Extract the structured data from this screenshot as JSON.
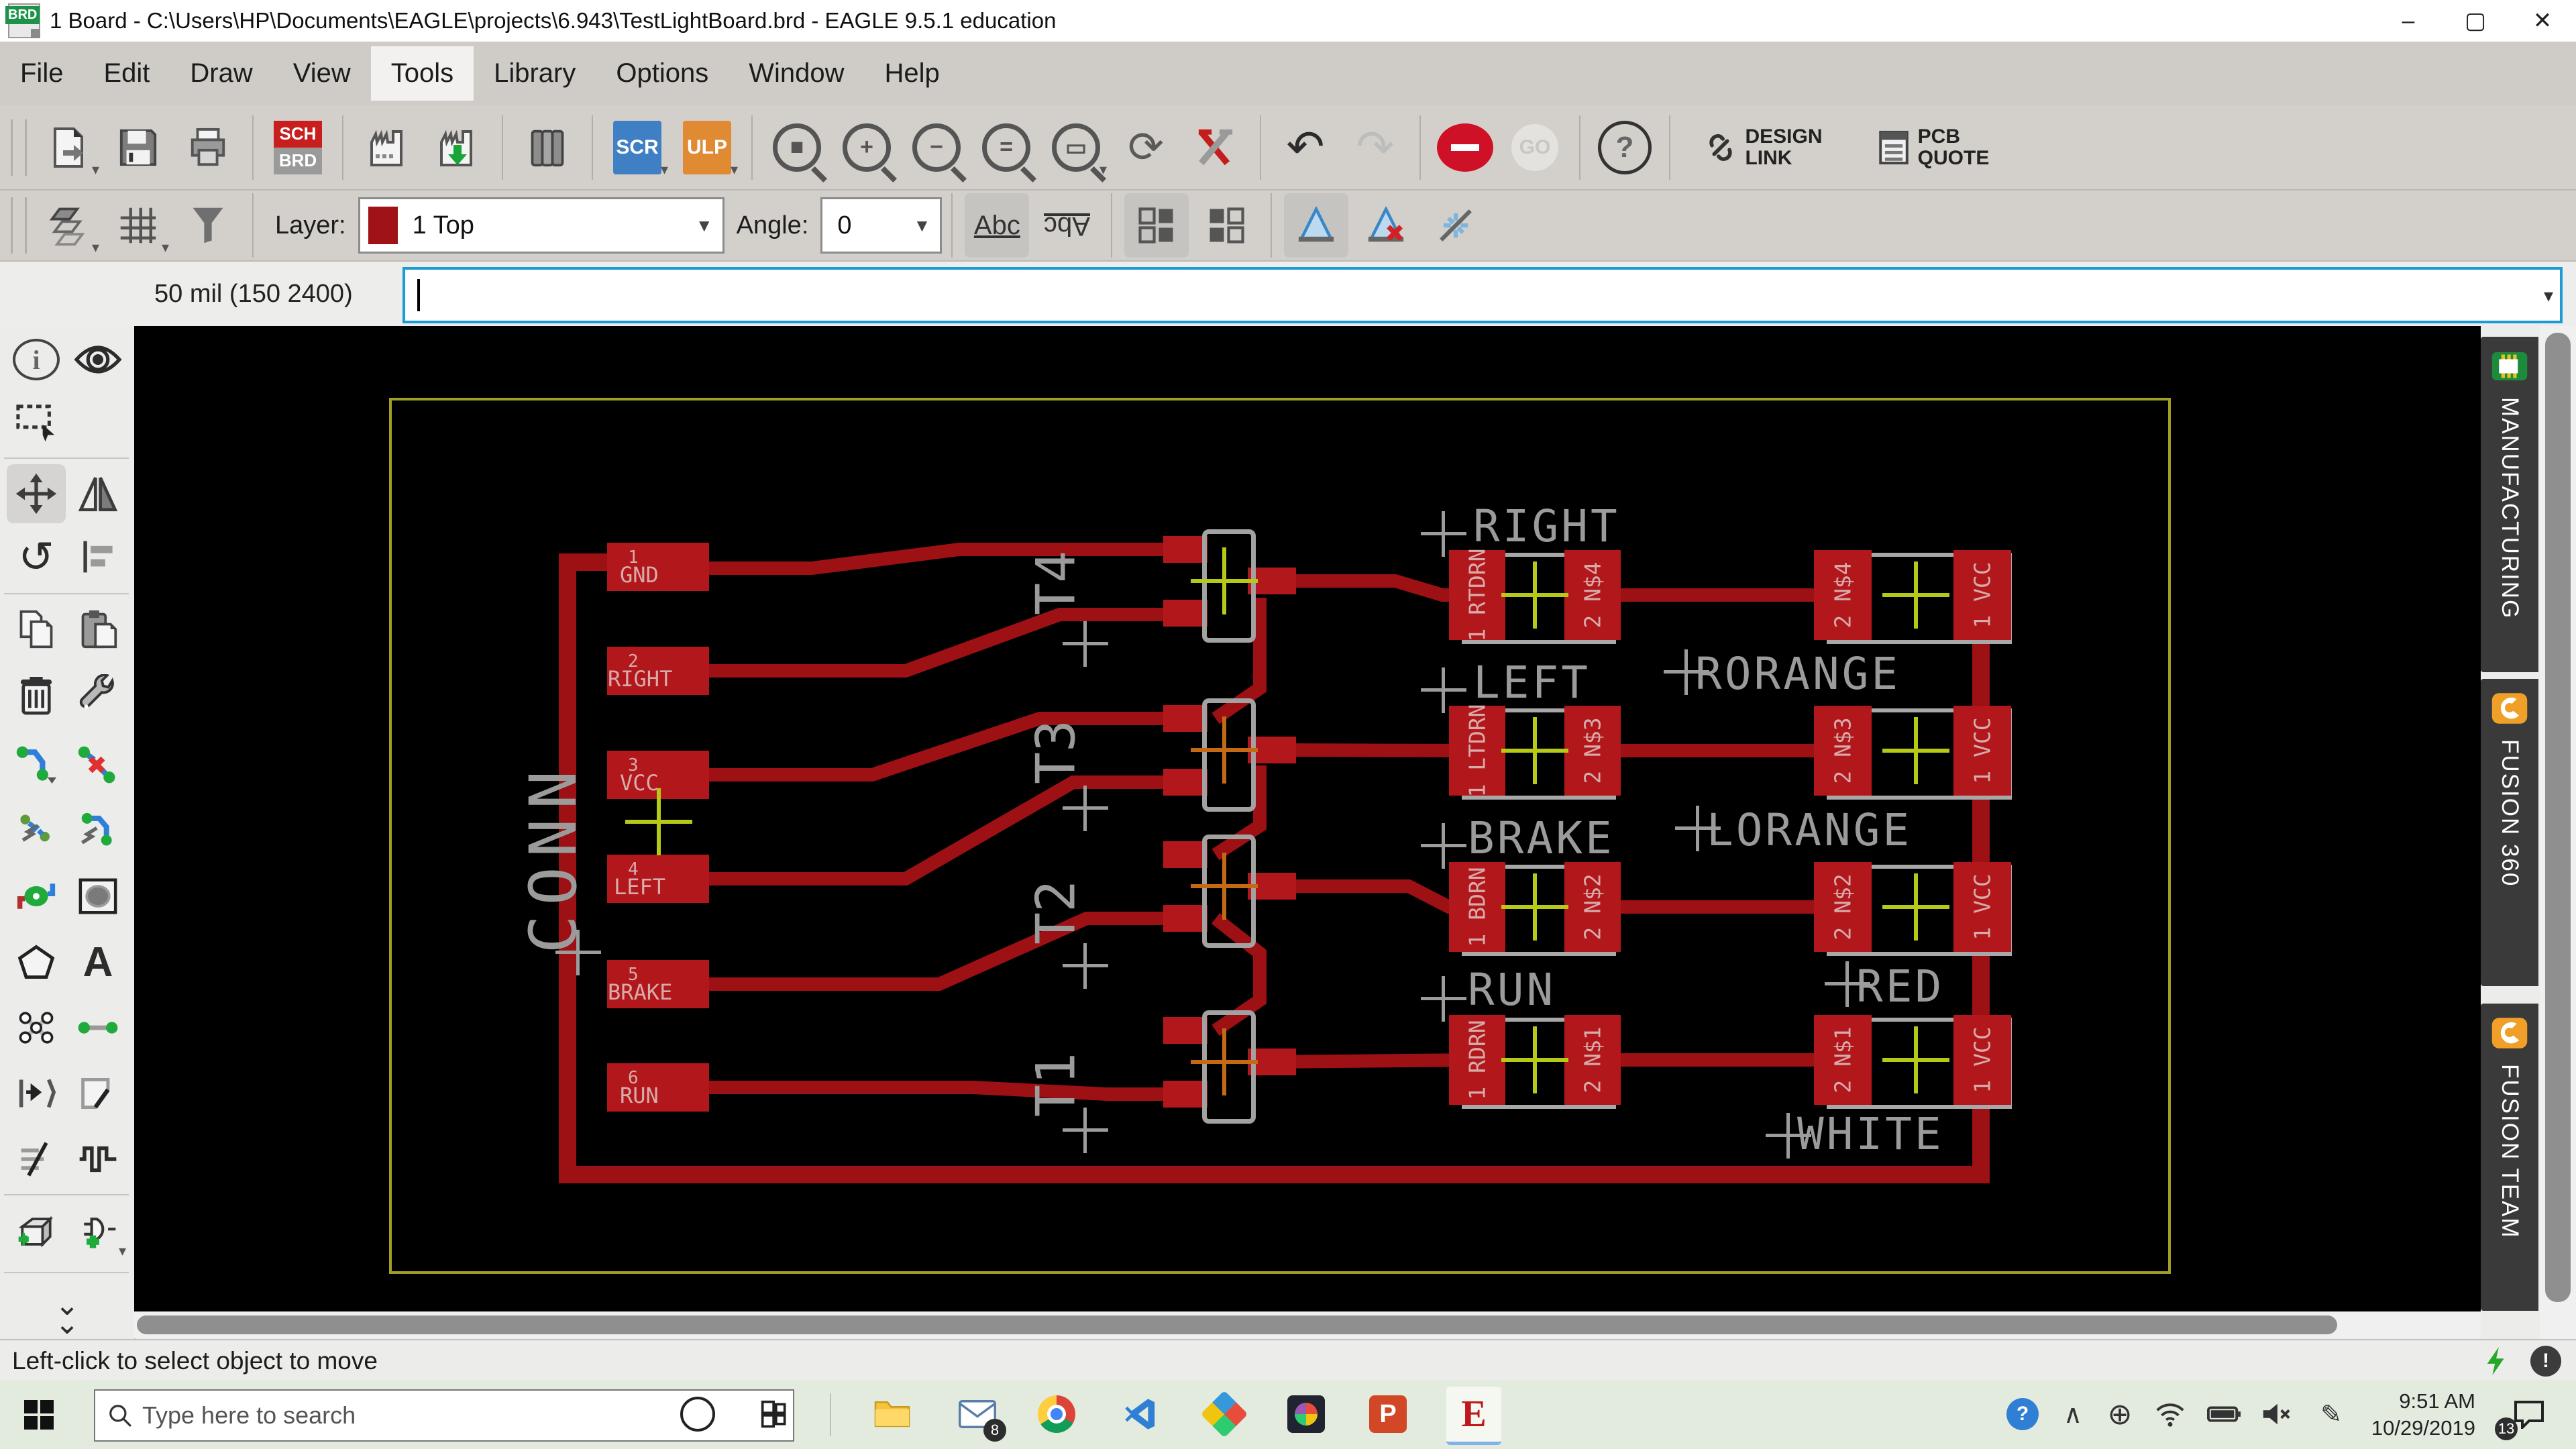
{
  "window": {
    "title": "1 Board - C:\\Users\\HP\\Documents\\EAGLE\\projects\\6.943\\TestLightBoard.brd - EAGLE 9.5.1 education",
    "icon_label": "BRD",
    "controls": {
      "minimize": "–",
      "maximize": "▢",
      "close": "✕"
    }
  },
  "menu": {
    "items": [
      {
        "label": "File"
      },
      {
        "label": "Edit"
      },
      {
        "label": "Draw"
      },
      {
        "label": "View"
      },
      {
        "label": "Tools"
      },
      {
        "label": "Library"
      },
      {
        "label": "Options"
      },
      {
        "label": "Window"
      },
      {
        "label": "Help"
      }
    ],
    "active": "Tools"
  },
  "toolbar": {
    "sch": "SCH",
    "brd": "BRD",
    "scr": "SCR",
    "ulp": "ULP",
    "go": "GO",
    "help": "?",
    "design_link_1": "DESIGN",
    "design_link_2": "LINK",
    "pcb_quote_1": "PCB",
    "pcb_quote_2": "QUOTE"
  },
  "toolbar2": {
    "layer_label": "Layer:",
    "layer_value": "1 Top",
    "angle_label": "Angle:",
    "angle_value": "0",
    "abc": "Abc"
  },
  "command": {
    "coords": "50 mil (150 2400)",
    "input_value": ""
  },
  "statusbar": {
    "text": "Left-click to select object to move",
    "alert": "!"
  },
  "side_tabs": [
    {
      "label": "MANUFACTURING"
    },
    {
      "label": "FUSION 360"
    },
    {
      "label": "FUSION TEAM"
    }
  ],
  "taskbar": {
    "search_placeholder": "Type here to search",
    "time": "9:51 AM",
    "date": "10/29/2019",
    "mail_badge": "8",
    "notif_badge": "13",
    "powerpoint_letter": "P",
    "eagle_letter": "E"
  },
  "icons": {
    "chevron_up": "∧",
    "globe": "⊕",
    "pen": "✎",
    "tray_help": "?"
  },
  "board": {
    "connector": {
      "name": "CONN",
      "pads": [
        {
          "num": "1",
          "name": "GND"
        },
        {
          "num": "2",
          "name": "RIGHT"
        },
        {
          "num": "3",
          "name": "VCC"
        },
        {
          "num": "4",
          "name": "LEFT"
        },
        {
          "num": "5",
          "name": "BRAKE"
        },
        {
          "num": "6",
          "name": "RUN"
        }
      ]
    },
    "transistors": [
      {
        "name": "T4"
      },
      {
        "name": "T3"
      },
      {
        "name": "T2"
      },
      {
        "name": "T1"
      }
    ],
    "resistors": [
      {
        "name": "RIGHT",
        "pad1": "1 RTDRN",
        "pad2": "2 N$4"
      },
      {
        "name": "LEFT",
        "pad1": "1 LTDRN",
        "pad2": "2 N$3"
      },
      {
        "name": "BRAKE",
        "pad1": "1 BDRN",
        "pad2": "2 N$2"
      },
      {
        "name": "RUN",
        "pad1": "1 RDRN",
        "pad2": "2 N$1"
      }
    ],
    "leds": [
      {
        "name": "RORANGE",
        "pad2": "2 N$4",
        "pad1": "1 VCC"
      },
      {
        "name": "LORANGE",
        "pad2": "2 N$3",
        "pad1": "1 VCC"
      },
      {
        "name": "RED",
        "pad2": "2 N$2",
        "pad1": "1 VCC"
      },
      {
        "name": "WHITE",
        "pad2": "2 N$1",
        "pad1": "1 VCC"
      }
    ]
  }
}
